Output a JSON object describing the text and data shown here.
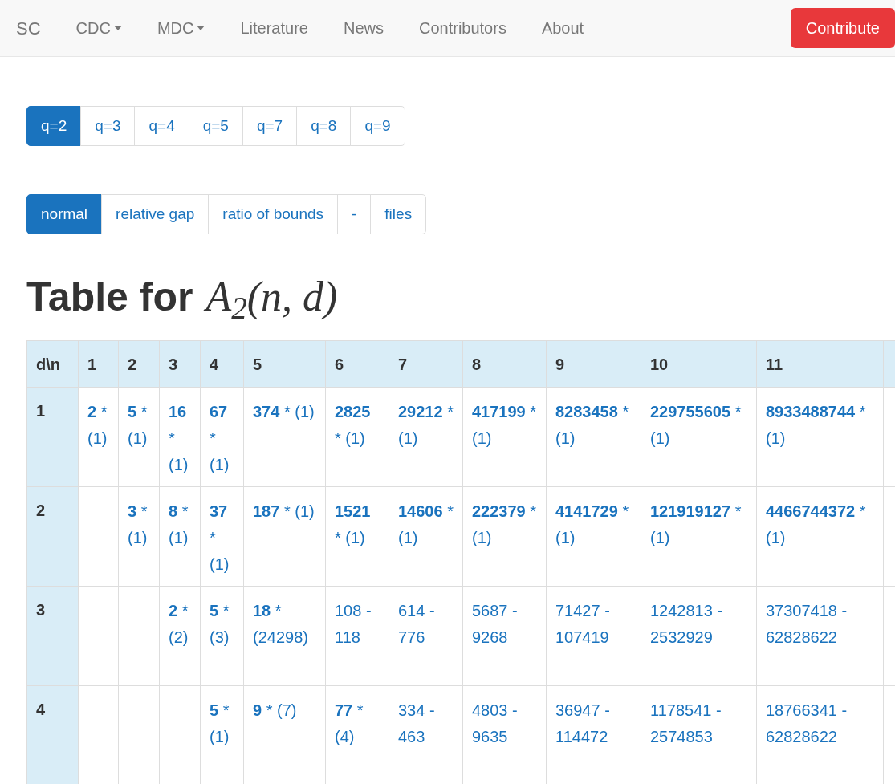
{
  "navbar": {
    "brand": "SC",
    "items": [
      {
        "label": "CDC",
        "kind": "dropdown"
      },
      {
        "label": "MDC",
        "kind": "dropdown"
      },
      {
        "label": "Literature",
        "kind": "link"
      },
      {
        "label": "News",
        "kind": "link"
      },
      {
        "label": "Contributors",
        "kind": "link"
      },
      {
        "label": "About",
        "kind": "link"
      }
    ],
    "action": "Contribute"
  },
  "q_tabs": [
    {
      "label": "q=2",
      "selected": true
    },
    {
      "label": "q=3",
      "selected": false
    },
    {
      "label": "q=4",
      "selected": false
    },
    {
      "label": "q=5",
      "selected": false
    },
    {
      "label": "q=7",
      "selected": false
    },
    {
      "label": "q=8",
      "selected": false
    },
    {
      "label": "q=9",
      "selected": false
    }
  ],
  "view_tabs": [
    {
      "label": "normal",
      "selected": true
    },
    {
      "label": "relative gap",
      "selected": false
    },
    {
      "label": "ratio of bounds",
      "selected": false
    },
    {
      "label": "-",
      "selected": false
    },
    {
      "label": "files",
      "selected": false
    }
  ],
  "heading": {
    "text": "Table for",
    "formula": "A$_{2}$(n, d)"
  },
  "table": {
    "corner": "d\\n",
    "columns": [
      "1",
      "2",
      "3",
      "4",
      "5",
      "6",
      "7",
      "8",
      "9",
      "10",
      "11"
    ],
    "rows": [
      {
        "d": "1",
        "cells": [
          "**2** * (1)",
          "**5** * (1)",
          "**16** * (1)",
          "**67** * (1)",
          "**374** * (1)",
          "**2825** * (1)",
          "**29212** * (1)",
          "**417199** * (1)",
          "**8283458** * (1)",
          "**229755605** * (1)",
          "**8933488744** * (1)"
        ]
      },
      {
        "d": "2",
        "cells": [
          "",
          "**3** * (1)",
          "**8** * (1)",
          "**37** * (1)",
          "**187** * (1)",
          "**1521** * (1)",
          "**14606** * (1)",
          "**222379** * (1)",
          "**4141729** * (1)",
          "**121919127** * (1)",
          "**4466744372** * (1)"
        ]
      },
      {
        "d": "3",
        "cells": [
          "",
          "",
          "**2** * (2)",
          "**5** * (3)",
          "**18** * (24298)",
          "108 - 118",
          "614 - 776",
          "5687 - 9268",
          "71427 - 107419",
          "1242813 - 2532929",
          "37307418 - 62828622"
        ]
      },
      {
        "d": "4",
        "cells": [
          "",
          "",
          "",
          "**5** * (1)",
          "**9** * (7)",
          "**77** * (4)",
          "334 - 463",
          "4803 - 9635",
          "36947 - 114472",
          "1178541 - 2574853",
          "18766341 - 62828622"
        ]
      }
    ]
  }
}
